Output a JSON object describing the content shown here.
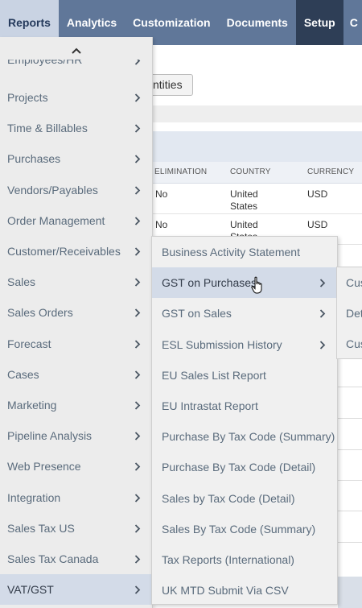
{
  "nav": {
    "items": [
      {
        "label": "Reports"
      },
      {
        "label": "Analytics"
      },
      {
        "label": "Customization"
      },
      {
        "label": "Documents"
      },
      {
        "label": "Setup"
      },
      {
        "label": "C"
      }
    ]
  },
  "background": {
    "button_label": "ntities",
    "table": {
      "headers": [
        "ELIMINATION",
        "COUNTRY",
        "CURRENCY"
      ],
      "rows": [
        {
          "elimination": "No",
          "country": "United States",
          "currency": "USD"
        },
        {
          "elimination": "No",
          "country": "United States",
          "currency": "USD"
        }
      ]
    }
  },
  "menu1": {
    "partial_item": "Employees/HR",
    "items": [
      {
        "label": "Projects"
      },
      {
        "label": "Time & Billables"
      },
      {
        "label": "Purchases"
      },
      {
        "label": "Vendors/Payables"
      },
      {
        "label": "Order Management"
      },
      {
        "label": "Customer/Receivables"
      },
      {
        "label": "Sales"
      },
      {
        "label": "Sales Orders"
      },
      {
        "label": "Forecast"
      },
      {
        "label": "Cases"
      },
      {
        "label": "Marketing"
      },
      {
        "label": "Pipeline Analysis"
      },
      {
        "label": "Web Presence"
      },
      {
        "label": "Integration"
      },
      {
        "label": "Sales Tax US"
      },
      {
        "label": "Sales Tax Canada"
      },
      {
        "label": "VAT/GST"
      }
    ],
    "selected": "VAT/GST"
  },
  "menu2": {
    "items": [
      {
        "label": "Business Activity Statement",
        "submenu": false
      },
      {
        "label": "GST on Purchases",
        "submenu": true
      },
      {
        "label": "GST on Sales",
        "submenu": true
      },
      {
        "label": "ESL Submission History",
        "submenu": true
      },
      {
        "label": "EU Sales List Report",
        "submenu": false
      },
      {
        "label": "EU Intrastat Report",
        "submenu": false
      },
      {
        "label": "Purchase By Tax Code (Summary)",
        "submenu": false
      },
      {
        "label": "Purchase By Tax Code (Detail)",
        "submenu": false
      },
      {
        "label": "Sales by Tax Code (Detail)",
        "submenu": false
      },
      {
        "label": "Sales By Tax Code (Summary)",
        "submenu": false
      },
      {
        "label": "Tax Reports (International)",
        "submenu": false
      },
      {
        "label": "UK MTD Submit Via CSV",
        "submenu": false
      }
    ],
    "hovered": "GST on Purchases"
  },
  "menu3": {
    "items": [
      {
        "label": "Cus"
      },
      {
        "label": "Det"
      },
      {
        "label": "Cus"
      }
    ]
  },
  "colors": {
    "nav_bg": "#607799",
    "nav_active_bg": "#c9d3e3",
    "setup_bg": "#2e3e56",
    "menu_bg": "#ececec",
    "menu_selected": "#d3dbe8",
    "menu_text": "#5a6b7c"
  },
  "icons": {
    "scroll_up": "chevron-up-icon",
    "submenu": "chevron-right-icon",
    "cursor": "hand-pointer-icon"
  }
}
